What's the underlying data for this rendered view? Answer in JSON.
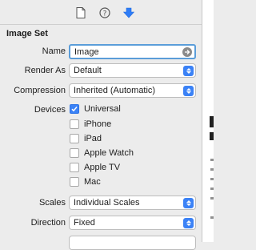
{
  "tabs": [
    {
      "name": "file-inspector-icon"
    },
    {
      "name": "quick-help-icon"
    },
    {
      "name": "attributes-inspector-icon",
      "active": true
    }
  ],
  "section_title": "Image Set",
  "name_field": {
    "label": "Name",
    "value": "Image"
  },
  "render_as": {
    "label": "Render As",
    "value": "Default"
  },
  "compression": {
    "label": "Compression",
    "value": "Inherited (Automatic)"
  },
  "devices": {
    "label": "Devices",
    "items": [
      {
        "label": "Universal",
        "checked": true
      },
      {
        "label": "iPhone",
        "checked": false
      },
      {
        "label": "iPad",
        "checked": false
      },
      {
        "label": "Apple Watch",
        "checked": false
      },
      {
        "label": "Apple TV",
        "checked": false
      },
      {
        "label": "Mac",
        "checked": false
      }
    ]
  },
  "scales": {
    "label": "Scales",
    "value": "Individual Scales"
  },
  "direction": {
    "label": "Direction",
    "value": "Fixed"
  },
  "colors": {
    "accent": "#3b82f6",
    "background": "#ececec"
  }
}
